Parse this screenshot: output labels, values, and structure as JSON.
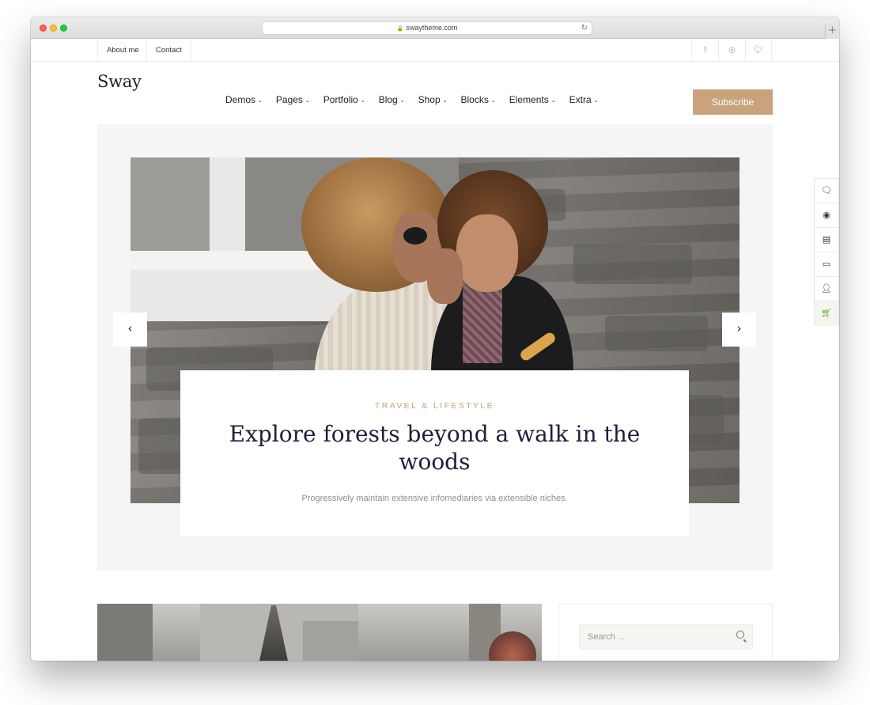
{
  "browser": {
    "url": "swaytheme.com"
  },
  "topbar": {
    "links": [
      "About me",
      "Contact"
    ],
    "social": [
      "facebook-icon",
      "instagram-icon",
      "twitter-icon"
    ]
  },
  "header": {
    "logo": "Sway",
    "nav": [
      "Demos",
      "Pages",
      "Portfolio",
      "Blog",
      "Shop",
      "Blocks",
      "Elements",
      "Extra"
    ],
    "subscribe_label": "Subscribe"
  },
  "hero": {
    "kicker": "TRAVEL & LIFESTYLE",
    "headline": "Explore forests beyond a walk in the woods",
    "excerpt": "Progressively maintain extensive infomediaries via extensible niches.",
    "prev_icon": "chevron-left-icon",
    "next_icon": "chevron-right-icon"
  },
  "side_rail": {
    "icons": [
      "chat-icon",
      "support-icon",
      "document-icon",
      "video-icon",
      "users-icon",
      "cart-icon"
    ]
  },
  "sidebar": {
    "search_placeholder": "Search ..."
  },
  "colors": {
    "accent": "#c8a37e",
    "headline": "#1f1f3a",
    "hero_bg": "#f5f5f5"
  }
}
